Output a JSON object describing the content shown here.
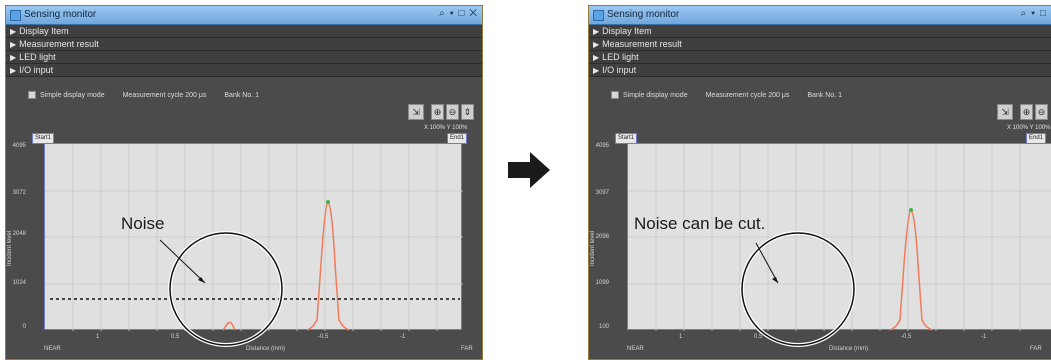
{
  "panels": [
    {
      "title": "Sensing monitor",
      "sections": [
        "Display Item",
        "Measurement result",
        "LED light",
        "I/O input"
      ],
      "simple_mode_label": "Simple display mode",
      "cycle_label": "Measurement cycle 200 μs",
      "bank_label": "Bank No. 1",
      "scale_readout": "X 100% Y 100%",
      "start_tag": "Start1",
      "end_tag": "End1",
      "y_ticks": [
        "4095",
        "3072",
        "2048",
        "1024",
        "0"
      ],
      "y_label": "Incident level",
      "x_ticks": [
        "NEAR",
        "1",
        "0.5",
        "Distance (mm)",
        "-0.5",
        "-1",
        "FAR"
      ],
      "callout": "Noise"
    },
    {
      "title": "Sensing monitor",
      "sections": [
        "Display Item",
        "Measurement result",
        "LED light",
        "I/O input"
      ],
      "simple_mode_label": "Simple display mode",
      "cycle_label": "Measurement cycle 200 μs",
      "bank_label": "Bank No. 1",
      "scale_readout": "X 100% Y 100%",
      "start_tag": "Start1",
      "end_tag": "End1",
      "y_ticks": [
        "4095",
        "3097",
        "2098",
        "1099",
        "100"
      ],
      "y_label": "Incident level",
      "x_ticks": [
        "NEAR",
        "1",
        "0.5",
        "Distance (mm)",
        "-0.5",
        "-1",
        "FAR"
      ],
      "callout": "Noise can be cut."
    }
  ],
  "colors": {
    "window_bg": "#4b4b4b",
    "plot_bg": "#e0e0e0",
    "waveform": "#f07a5a",
    "peak_marker": "#3cb24a",
    "arrow": "#1a1a1a"
  },
  "icons": [
    "window-icon",
    "zoom-icon",
    "zoom-in-icon",
    "zoom-out-icon",
    "fit-icon",
    "minimize-icon",
    "maximize-icon",
    "close-icon",
    "right-arrow-icon"
  ]
}
